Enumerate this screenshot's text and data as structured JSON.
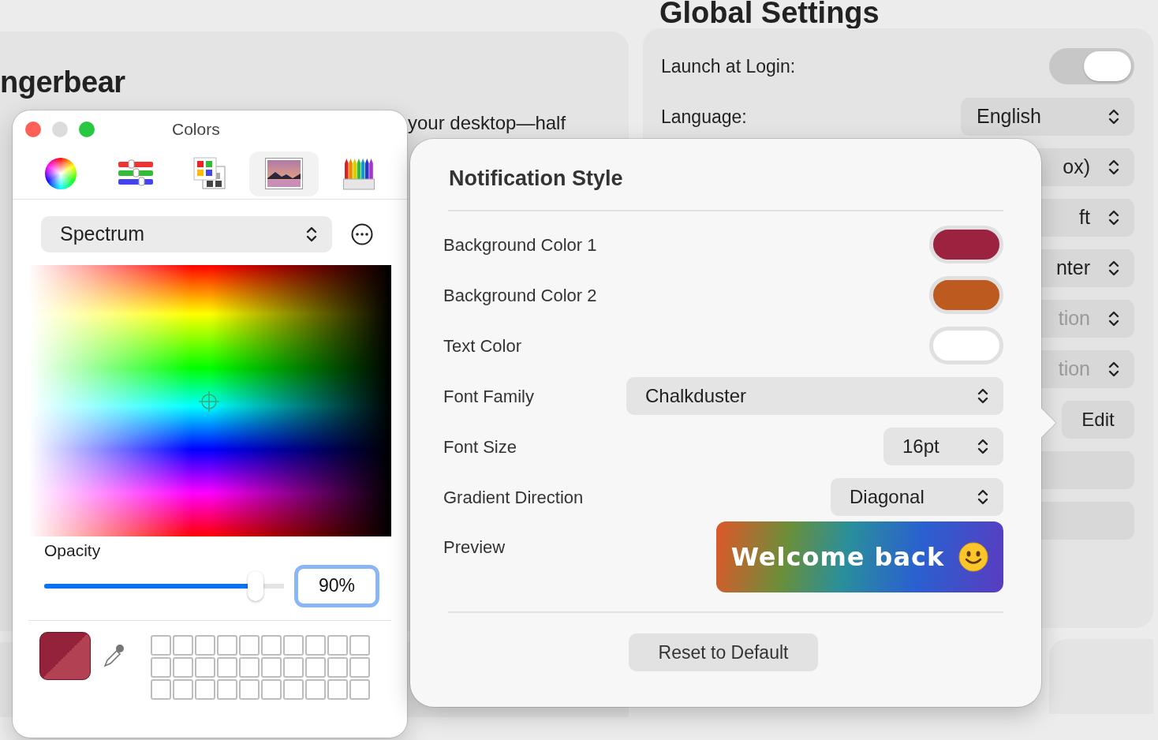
{
  "left_panel": {
    "title": "ngerbear",
    "text": "your desktop—half"
  },
  "global_settings": {
    "title": "Global Settings",
    "rows": [
      {
        "kind": "toggle",
        "label": "Launch at Login:",
        "on": true
      },
      {
        "kind": "select",
        "label": "Language:",
        "value": "English",
        "disabled": false
      },
      {
        "kind": "select",
        "value": "ox)",
        "disabled": false
      },
      {
        "kind": "select",
        "value": "ft",
        "disabled": false
      },
      {
        "kind": "select",
        "value": "nter",
        "disabled": false
      },
      {
        "kind": "select",
        "value": "tion",
        "disabled": true
      },
      {
        "kind": "select",
        "value": "tion",
        "disabled": true
      },
      {
        "kind": "button",
        "value": "Edit"
      },
      {
        "kind": "button"
      },
      {
        "kind": "button"
      }
    ]
  },
  "colors_window": {
    "title": "Colors",
    "tabs": [
      {
        "kind": "wheel",
        "selected": false
      },
      {
        "kind": "sliders",
        "selected": false
      },
      {
        "kind": "palettes",
        "selected": false
      },
      {
        "kind": "image",
        "selected": true
      },
      {
        "kind": "pencils",
        "selected": false
      }
    ],
    "mode": "Spectrum",
    "opacity_label": "Opacity",
    "opacity": {
      "level": 0.88
    },
    "opacity_value": "90%"
  },
  "notification_style": {
    "title": "Notification Style",
    "rows": [
      {
        "kind": "color",
        "label": "Background Color 1",
        "color": "#9c2340"
      },
      {
        "kind": "color",
        "label": "Background Color 2",
        "color": "#bd5a20"
      },
      {
        "kind": "color",
        "label": "Text Color",
        "color": "#ffffff"
      },
      {
        "kind": "select",
        "label": "Font Family",
        "value": "Chalkduster"
      },
      {
        "kind": "select",
        "label": "Font Size",
        "value": "16pt"
      },
      {
        "kind": "select",
        "label": "Gradient Direction",
        "value": "Diagonal"
      },
      {
        "kind": "preview",
        "label": "Preview",
        "text": "Welcome back"
      }
    ],
    "reset_button": "Reset to Default"
  }
}
